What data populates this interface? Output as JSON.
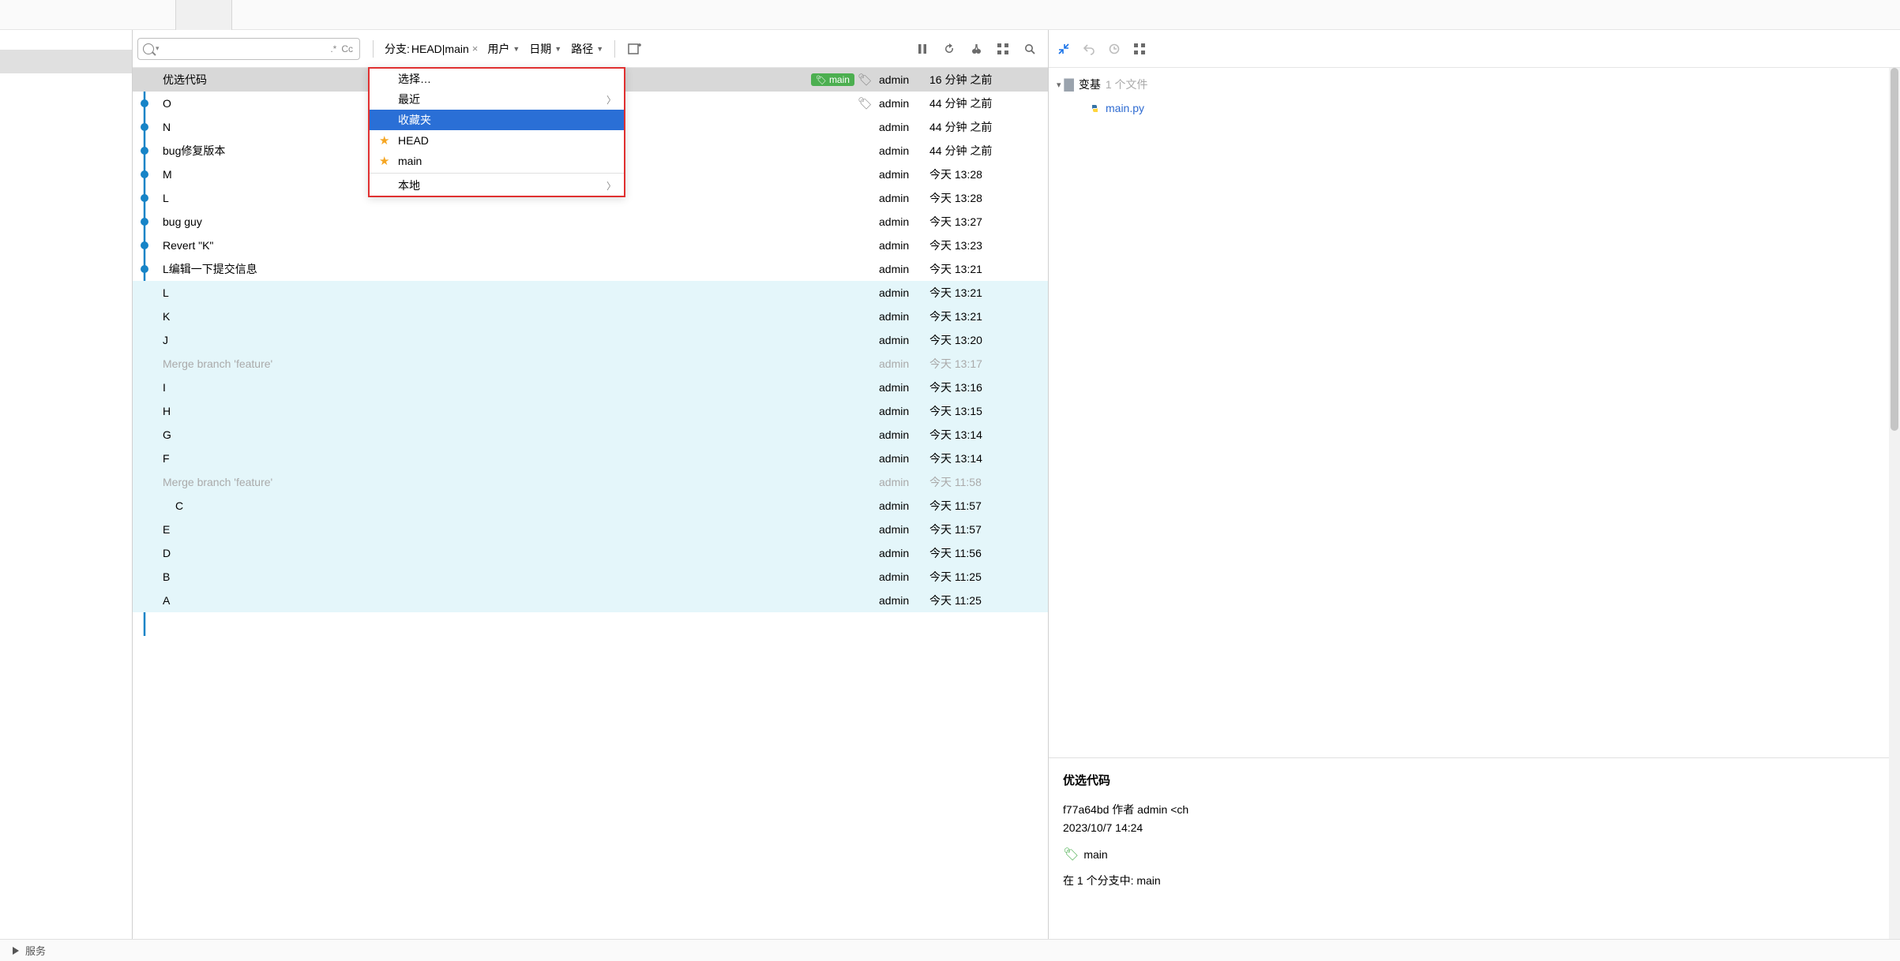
{
  "filters": {
    "branch_label": "分支:",
    "branch_value": "HEAD|main",
    "user_label": "用户",
    "date_label": "日期",
    "path_label": "路径"
  },
  "popup": {
    "select": "选择…",
    "recent": "最近",
    "favorites": "收藏夹",
    "head": "HEAD",
    "main": "main",
    "local": "本地"
  },
  "commits": [
    {
      "msg": "优选代码",
      "author": "admin",
      "date": "16 分钟 之前",
      "selected": true,
      "badge": "main",
      "tag": true,
      "indent": 0
    },
    {
      "msg": "O",
      "author": "admin",
      "date": "44 分钟 之前",
      "tag": true,
      "indent": 0
    },
    {
      "msg": "N",
      "author": "admin",
      "date": "44 分钟 之前",
      "indent": 0
    },
    {
      "msg": "bug修复版本",
      "author": "admin",
      "date": "44 分钟 之前",
      "indent": 0
    },
    {
      "msg": "M",
      "author": "admin",
      "date": "今天 13:28",
      "indent": 0
    },
    {
      "msg": "L",
      "author": "admin",
      "date": "今天 13:28",
      "indent": 0
    },
    {
      "msg": "bug guy",
      "author": "admin",
      "date": "今天 13:27",
      "indent": 0
    },
    {
      "msg": "Revert \"K\"",
      "author": "admin",
      "date": "今天 13:23",
      "indent": 0
    },
    {
      "msg": "L编辑一下提交信息",
      "author": "admin",
      "date": "今天 13:21",
      "indent": 0
    },
    {
      "msg": "L",
      "author": "admin",
      "date": "今天 13:21",
      "highlight": true,
      "indent": 0
    },
    {
      "msg": "K",
      "author": "admin",
      "date": "今天 13:21",
      "highlight": true,
      "indent": 0
    },
    {
      "msg": "J",
      "author": "admin",
      "date": "今天 13:20",
      "highlight": true,
      "indent": 0
    },
    {
      "msg": "Merge branch 'feature'",
      "author": "admin",
      "date": "今天 13:17",
      "highlight": true,
      "merge": true,
      "indent": 0
    },
    {
      "msg": "I",
      "author": "admin",
      "date": "今天 13:16",
      "highlight": true,
      "indent": 0
    },
    {
      "msg": "H",
      "author": "admin",
      "date": "今天 13:15",
      "highlight": true,
      "indent": 0
    },
    {
      "msg": "G",
      "author": "admin",
      "date": "今天 13:14",
      "highlight": true,
      "indent": 0
    },
    {
      "msg": "F",
      "author": "admin",
      "date": "今天 13:14",
      "highlight": true,
      "indent": 0
    },
    {
      "msg": "Merge branch 'feature'",
      "author": "admin",
      "date": "今天 11:58",
      "highlight": true,
      "merge": true,
      "indent": 0
    },
    {
      "msg": "C",
      "author": "admin",
      "date": "今天 11:57",
      "highlight": true,
      "indent": 1
    },
    {
      "msg": "E",
      "author": "admin",
      "date": "今天 11:57",
      "highlight": true,
      "indent": 0
    },
    {
      "msg": "D",
      "author": "admin",
      "date": "今天 11:56",
      "highlight": true,
      "indent": 0
    },
    {
      "msg": "B",
      "author": "admin",
      "date": "今天 11:25",
      "highlight": true,
      "indent": 0
    },
    {
      "msg": "A",
      "author": "admin",
      "date": "今天 11:25",
      "highlight": true,
      "indent": 0
    }
  ],
  "right": {
    "folder_label": "变基",
    "folder_count": "1 个文件",
    "file": "main.py"
  },
  "details": {
    "title": "优选代码",
    "hash_line": "f77a64bd 作者 admin <ch",
    "date_line": "2023/10/7 14:24",
    "branch": "main",
    "in_branches": "在 1 个分支中: main"
  },
  "bottombar": {
    "service": "服务"
  }
}
